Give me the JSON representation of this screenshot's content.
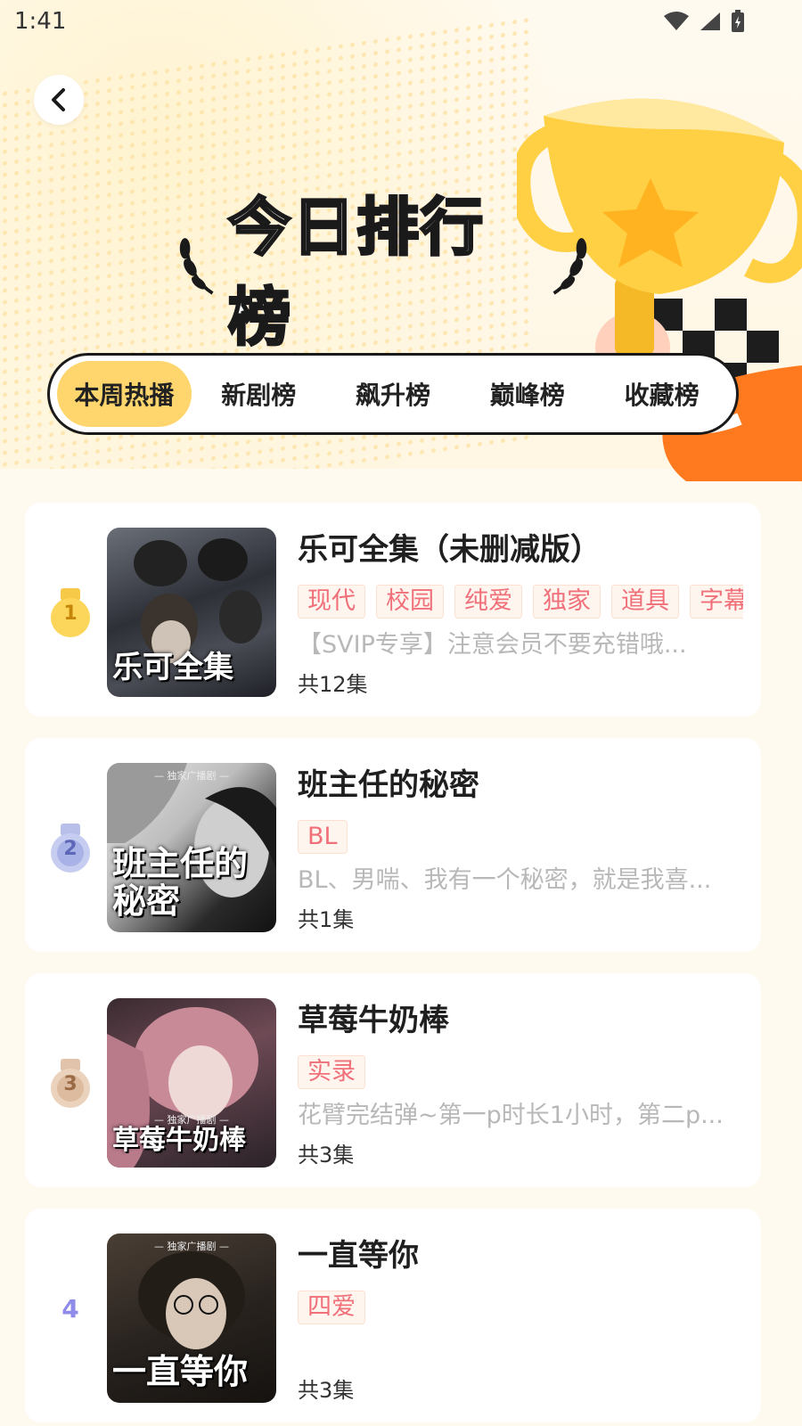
{
  "status_bar": {
    "time": "1:41"
  },
  "header": {
    "title": "今日排行榜"
  },
  "tabs": [
    {
      "label": "本周热播",
      "active": true
    },
    {
      "label": "新剧榜",
      "active": false
    },
    {
      "label": "飙升榜",
      "active": false
    },
    {
      "label": "巅峰榜",
      "active": false
    },
    {
      "label": "收藏榜",
      "active": false
    }
  ],
  "items": [
    {
      "rank": "1",
      "title": "乐可全集（未删减版）",
      "cover_text": "乐可全集",
      "tags": [
        "现代",
        "校园",
        "纯爱",
        "独家",
        "道具",
        "字幕"
      ],
      "desc": "【SVIP专享】注意会员不要充错哦...",
      "episodes": "共12集"
    },
    {
      "rank": "2",
      "title": "班主任的秘密",
      "cover_text": "班主任的秘密",
      "cover_sub": "— 独家广播剧 —",
      "tags": [
        "BL"
      ],
      "desc": "BL、男喘、我有一个秘密，就是我喜...",
      "episodes": "共1集"
    },
    {
      "rank": "3",
      "title": "草莓牛奶棒",
      "cover_text": "草莓牛奶棒",
      "cover_sub": "— 独家广播剧 —",
      "tags": [
        "实录"
      ],
      "desc": "花臂完结弹~第一p时长1小时，第二p...",
      "episodes": "共3集"
    },
    {
      "rank": "4",
      "title": "一直等你",
      "cover_text": "一直等你",
      "cover_sub": "— 独家广播剧 —",
      "tags": [
        "四爱"
      ],
      "desc": "",
      "episodes": "共3集"
    }
  ],
  "colors": {
    "accent": "#ffd66e",
    "tag_text": "#f0707a",
    "gold": "#f7c948",
    "silver": "#9fa8e0",
    "bronze": "#d9b79a",
    "rank_other": "#8f8be8"
  }
}
